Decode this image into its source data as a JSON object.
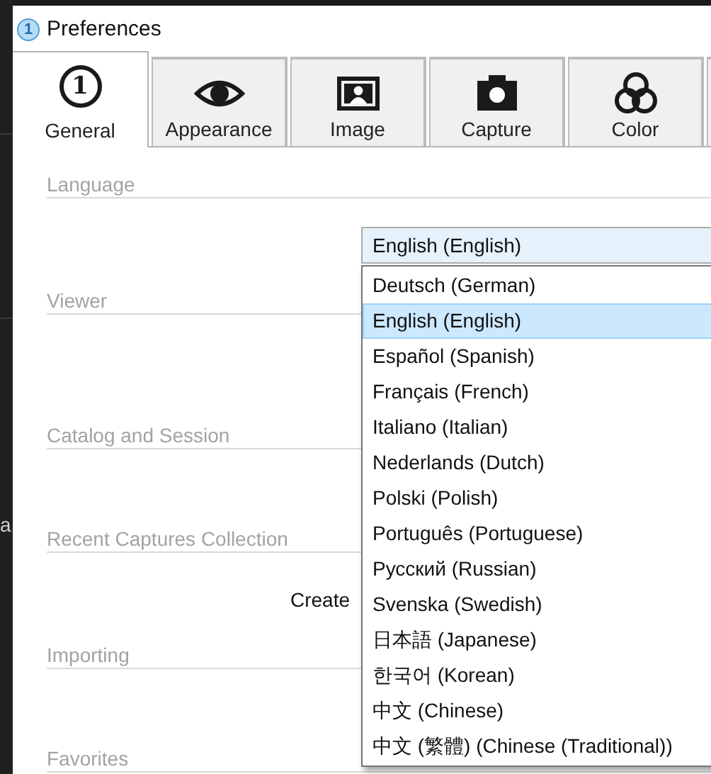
{
  "background_app": {
    "text": "a"
  },
  "window": {
    "icon_text": "1",
    "title": "Preferences"
  },
  "tabs": [
    {
      "kind": "number",
      "icon_text": "1",
      "label": "General",
      "selected": true
    },
    {
      "kind": "eye",
      "label": "Appearance",
      "selected": false
    },
    {
      "kind": "image",
      "label": "Image",
      "selected": false
    },
    {
      "kind": "camera",
      "label": "Capture",
      "selected": false
    },
    {
      "kind": "circles",
      "label": "Color",
      "selected": false
    }
  ],
  "sections": {
    "language": "Language",
    "viewer": "Viewer",
    "catalog": "Catalog and Session",
    "recent": "Recent Captures Collection",
    "create_label": "Create",
    "importing": "Importing",
    "favorites": "Favorites"
  },
  "language_select": {
    "value": "English (English)",
    "expanded": true,
    "options": [
      {
        "label": "Deutsch (German)",
        "selected": false
      },
      {
        "label": "English (English)",
        "selected": true
      },
      {
        "label": "Español (Spanish)",
        "selected": false
      },
      {
        "label": "Français (French)",
        "selected": false
      },
      {
        "label": "Italiano (Italian)",
        "selected": false
      },
      {
        "label": "Nederlands (Dutch)",
        "selected": false
      },
      {
        "label": "Polski (Polish)",
        "selected": false
      },
      {
        "label": "Português (Portuguese)",
        "selected": false
      },
      {
        "label": "Русский (Russian)",
        "selected": false
      },
      {
        "label": "Svenska (Swedish)",
        "selected": false
      },
      {
        "label": "日本語 (Japanese)",
        "selected": false
      },
      {
        "label": "한국어 (Korean)",
        "selected": false
      },
      {
        "label": "中文 (Chinese)",
        "selected": false
      },
      {
        "label": "中文 (繁體) (Chinese (Traditional))",
        "selected": false
      }
    ]
  }
}
